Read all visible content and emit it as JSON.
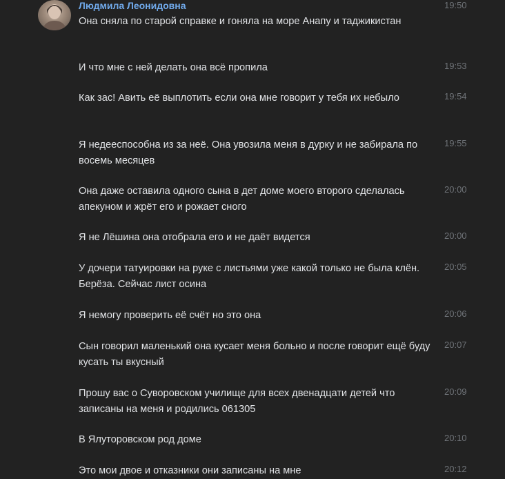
{
  "sender": {
    "name": "Людмила Леонидовна"
  },
  "messages": [
    {
      "text": "Она сняла по старой справке и гоняла на море Анапу и таджикистан",
      "time": "19:50"
    },
    {
      "text": "И что мне с ней делать она всё пропила",
      "time": "19:53"
    },
    {
      "text": "Как зас! Авить её выплотить если она мне говорит у тебя их небыло",
      "time": "19:54"
    },
    {
      "text": "Я недееспособна из за неё. Она увозила меня в дурку и не забирала по восемь месяцев",
      "time": "19:55"
    },
    {
      "text": "Она даже оставила одного сына в дет доме моего второго сделалась апекуном и жрёт его и рожает сного",
      "time": "20:00"
    },
    {
      "text": "Я не Лёшина она отобрала его и не даёт видется",
      "time": "20:00"
    },
    {
      "text": "У дочери татуировки на руке с листьями уже какой только не была клён. Берёза. Сейчас лист осина",
      "time": "20:05"
    },
    {
      "text": "Я немогу проверить её счёт но это она",
      "time": "20:06"
    },
    {
      "text": "Сын говорил маленький она кусает меня больно и после говорит ещё буду кусать ты вкусный",
      "time": "20:07"
    },
    {
      "text": "Прошу вас о Суворовском училище для всех двенадцати детей что записаны на меня и родились 061305",
      "time": "20:09"
    },
    {
      "text": "В Ялуторовском род доме",
      "time": "20:10"
    },
    {
      "text": "Это мои двое и отказники они записаны на мне",
      "time": "20:12"
    }
  ]
}
